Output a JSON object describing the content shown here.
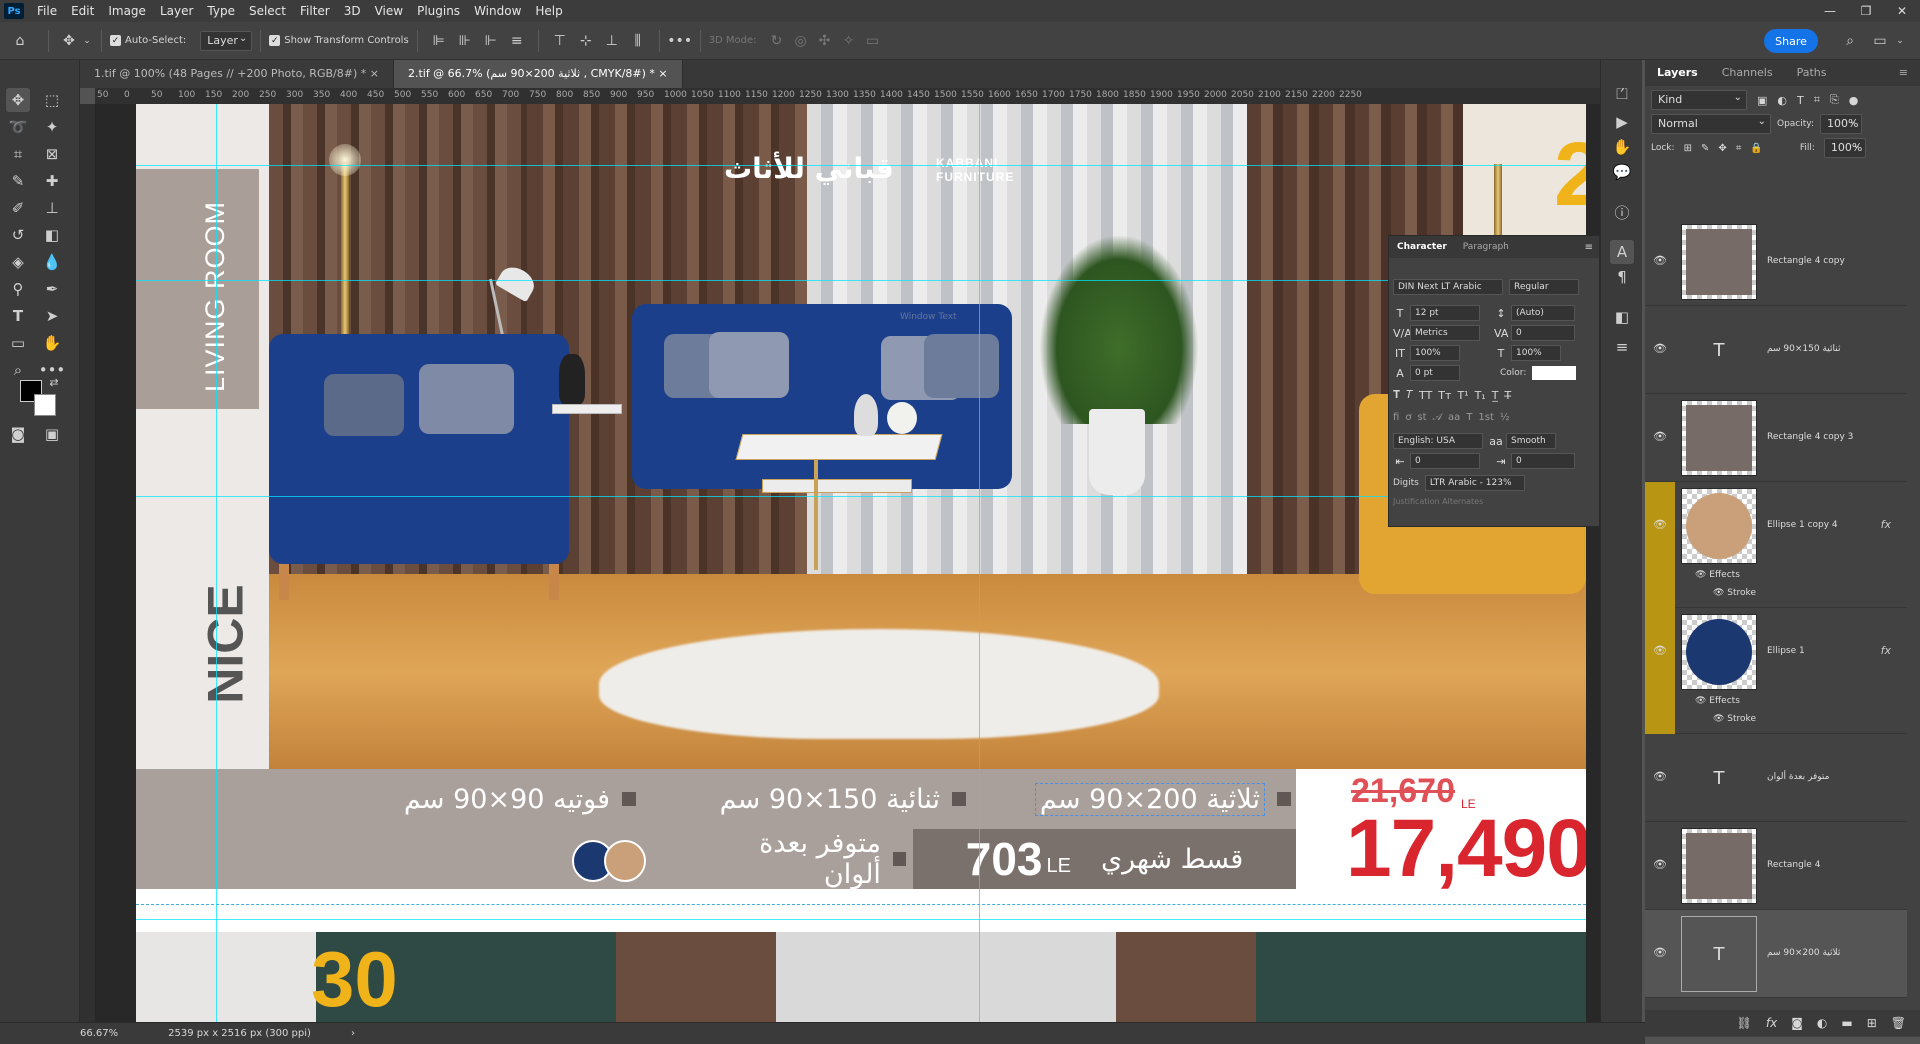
{
  "menu": {
    "app_badge": "Ps",
    "items": [
      "File",
      "Edit",
      "Image",
      "Layer",
      "Type",
      "Select",
      "Filter",
      "3D",
      "View",
      "Plugins",
      "Window",
      "Help"
    ]
  },
  "window_buttons": [
    "—",
    "❐",
    "✕"
  ],
  "options": {
    "auto_select_label": "Auto-Select:",
    "auto_select_target": "Layer",
    "transform_label": "Show Transform Controls",
    "mode_3d": "3D Mode:",
    "share_label": "Share"
  },
  "tabs": [
    {
      "label": "1.tif @ 100% (48 Pages // +200 Photo, RGB/8#) *",
      "close": "×"
    },
    {
      "label": "2.tif @ 66.7% (ثلاثية 200×90 سم , CMYK/8#) *",
      "close": "×"
    }
  ],
  "ruler_ticks": [
    "50",
    "0",
    "50",
    "100",
    "150",
    "200",
    "250",
    "300",
    "350",
    "400",
    "450",
    "500",
    "550",
    "600",
    "650",
    "700",
    "750",
    "800",
    "850",
    "900",
    "950",
    "1000",
    "1050",
    "1100",
    "1150",
    "1200",
    "1250",
    "1300",
    "1350",
    "1400",
    "1450",
    "1500",
    "1550",
    "1600",
    "1650",
    "1700",
    "1750",
    "1800",
    "1850",
    "1900",
    "1950",
    "2000",
    "2050",
    "2100",
    "2150",
    "2200",
    "2250"
  ],
  "artwork": {
    "vertical_title": "LIVING ROOM",
    "vertical_nice": "NICE",
    "brand_ar": "قباني للأثاث",
    "brand_en_1": "KABBANI",
    "brand_en_2": "FURNITURE",
    "corner_digit": "2",
    "item_sofa3": "ثلاثية 200×90 سم",
    "item_sofa2": "ثنائية 150×90 سم",
    "item_chair": "فوتيه 90×90 سم",
    "colors_label": "متوفر بعدة ألوان",
    "installment_label": "قسط شهري",
    "installment_value": "703",
    "currency": "LE",
    "old_price": "21,670",
    "new_price": "17,490",
    "next_artboard_digit": "30",
    "swatch_navy": "#1c3870",
    "swatch_tan": "#c9a07a",
    "accent_red": "#d8252e"
  },
  "character": {
    "tabs": [
      "Character",
      "Paragraph"
    ],
    "font_family": "DIN Next LT Arabic",
    "font_style": "Regular",
    "size": "12 pt",
    "leading": "(Auto)",
    "kerning": "Metrics",
    "tracking": "0",
    "vscale": "100%",
    "hscale": "100%",
    "baseline": "0 pt",
    "color_label": "Color:",
    "language": "English: USA",
    "aa_label": "aa",
    "antialias": "Smooth",
    "indent_left": "0",
    "indent_right": "0",
    "digits_label": "Digits",
    "digits_value": "LTR Arabic - 123%",
    "justification": "Justification Alternates",
    "ghost_text": "Window Text"
  },
  "layers": {
    "tabs": [
      "Layers",
      "Channels",
      "Paths"
    ],
    "filter_kind": "Kind",
    "blend_mode": "Normal",
    "opacity_label": "Opacity:",
    "opacity": "100%",
    "lock_label": "Lock:",
    "fill_label": "Fill:",
    "fill": "100%",
    "rows": [
      {
        "name": "Rectangle 4 copy",
        "kind": "shape",
        "color": "#776b67"
      },
      {
        "name": "ثنائية 150×90 سم",
        "kind": "text"
      },
      {
        "name": "Rectangle 4 copy 3",
        "kind": "shape",
        "color": "#776b67"
      },
      {
        "name": "Ellipse 1 copy 4",
        "kind": "shape",
        "color": "#c9a07a",
        "fx": "fx",
        "effects": "Effects",
        "stroke": "Stroke"
      },
      {
        "name": "Ellipse 1",
        "kind": "shape",
        "color": "#1c3870",
        "fx": "fx",
        "effects": "Effects",
        "stroke": "Stroke"
      },
      {
        "name": "متوفر بعدة ألوان",
        "kind": "text"
      },
      {
        "name": "Rectangle 4",
        "kind": "shape",
        "color": "#776b67"
      },
      {
        "name": "ثلاثية 200×90 سم",
        "kind": "text"
      }
    ]
  },
  "status": {
    "zoom": "66.67%",
    "doc_info": "2539 px x 2516 px (300 ppi)"
  }
}
